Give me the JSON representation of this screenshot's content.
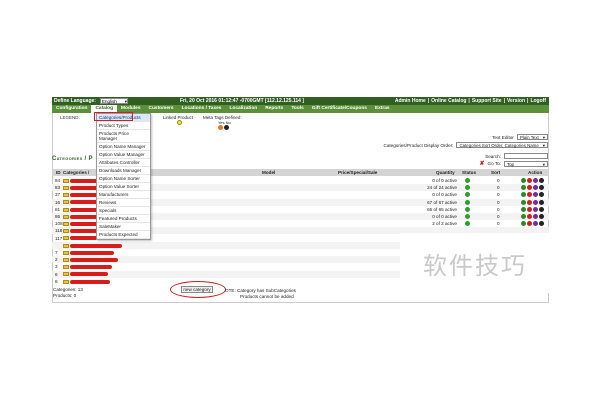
{
  "topbar": {
    "define_language_label": "Define Language:",
    "language_value": "English",
    "datetime": "Fri, 20 Oct 2016 01:12:47 -0700GMT [112.12.125.114 ]",
    "links": [
      "Admin Home",
      "|",
      "Online Catalog",
      "|",
      "Support Site",
      "|",
      "Version",
      "|",
      "Logoff"
    ]
  },
  "mainmenu": [
    "Configuration",
    "Catalog",
    "Modules",
    "Customers",
    "Locations / Taxes",
    "Localization",
    "Reports",
    "Tools",
    "Gift Certificate/Coupons",
    "Extras"
  ],
  "dropdown": {
    "items": [
      "Categories/Products",
      "Product Types",
      "Products Price Manager",
      "Option Name Manager",
      "Option Value Manager",
      "Attributes Controller",
      "Downloads Manager",
      "Option Name Sorter",
      "Option Value Sorter",
      "Manufacturers",
      "Reviews",
      "Specials",
      "Featured Products",
      "SaleMaker",
      "Products Expected"
    ]
  },
  "legend": {
    "label": "LEGEND:",
    "gen": "oducts",
    "linked": "Linked Product",
    "meta": "Meta Tags Defined:",
    "yesno": "Yes No"
  },
  "controls": {
    "text_editor_label": "Text Editor",
    "text_editor_value": "Plain Text",
    "display_order_label": "Categories/Product Display Order:",
    "display_order_value": "Categories Sort Order, Categories Name",
    "search_label": "Search:",
    "goto_label": "Go To:",
    "goto_value": "Top"
  },
  "page_title": "Categories / P",
  "table": {
    "headers": {
      "id": "ID",
      "name": "Categories /",
      "model": "Model",
      "price": "Price/Special/Sale",
      "quantity": "Quantity",
      "status": "Status",
      "sort": "Sort",
      "action": "Action"
    },
    "rows": [
      {
        "id": "84",
        "quantity": "0 of 0 active",
        "sort": "0"
      },
      {
        "id": "83",
        "quantity": "24 of 24 active",
        "sort": "0"
      },
      {
        "id": "37",
        "quantity": "0 of 0 active",
        "sort": "0"
      },
      {
        "id": "16",
        "quantity": "67 of 67 active",
        "sort": "0"
      },
      {
        "id": "81",
        "quantity": "65 of 65 active",
        "sort": "0"
      },
      {
        "id": "86",
        "quantity": "0 of 0 active",
        "sort": "0"
      },
      {
        "id": "108",
        "quantity": "2 of 2 active",
        "sort": "0"
      },
      {
        "id": "118",
        "quantity": "",
        "sort": ""
      },
      {
        "id": "117",
        "quantity": "",
        "sort": ""
      },
      {
        "id": "",
        "quantity": "",
        "sort": ""
      },
      {
        "id": "7",
        "quantity": "",
        "sort": ""
      },
      {
        "id": "2",
        "quantity": "",
        "sort": ""
      },
      {
        "id": "3",
        "quantity": "",
        "sort": ""
      },
      {
        "id": "6",
        "quantity": "",
        "sort": ""
      },
      {
        "id": "8",
        "quantity": "",
        "sort": ""
      }
    ]
  },
  "footer": {
    "categories_count": "Categories: 13",
    "products_count": "Products: 0",
    "new_category_button": "new category",
    "note_line1": "OTE: Category has SubCategories",
    "note_line2": "Products cannot be added"
  },
  "watermark": "软件技巧",
  "colors": {
    "topbar": "#2f5f21",
    "menu": "#5b8f3a",
    "highlight_red": "#d01f1f",
    "status_green": "#2aa02a"
  }
}
